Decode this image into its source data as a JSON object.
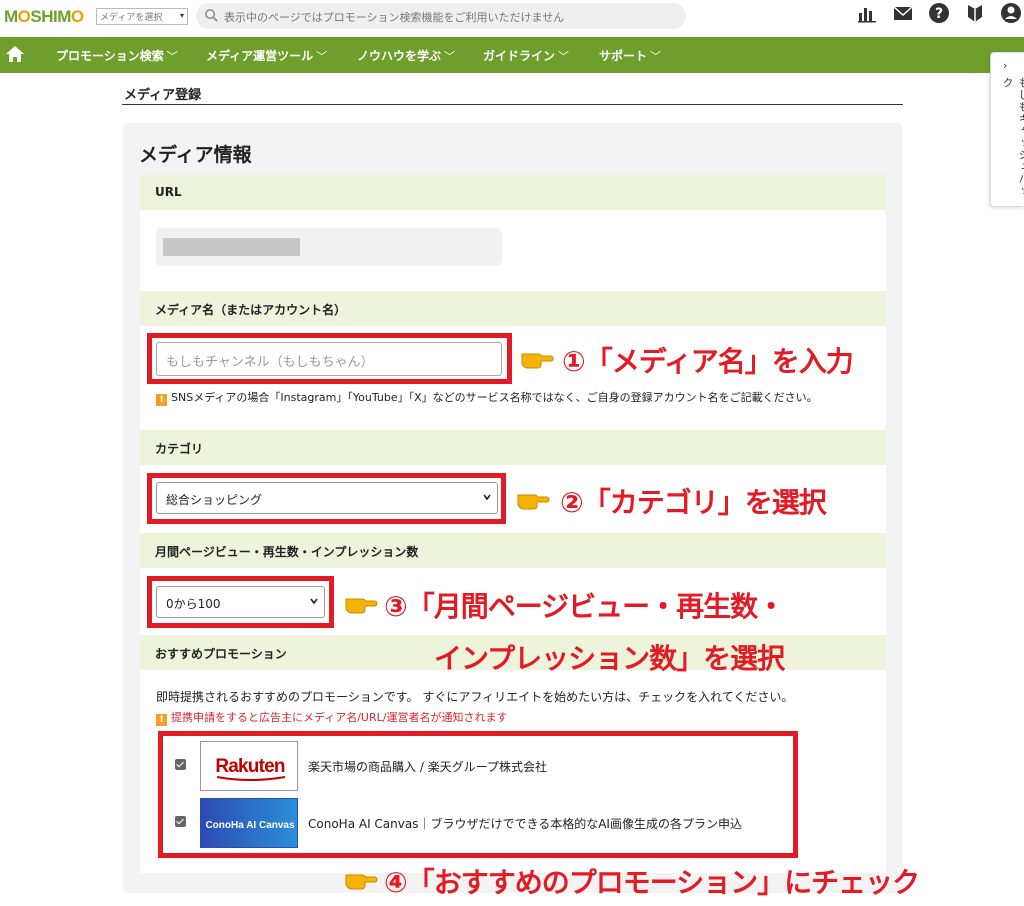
{
  "topbar": {
    "logo": "MOSHIMO",
    "media_select": "メディアを選択",
    "search_placeholder": "表示中のページではプロモーション検索機能をご利用いただけません"
  },
  "nav": {
    "items": [
      "プロモーション検索",
      "メディア運営ツール",
      "ノウハウを学ぶ",
      "ガイドライン",
      "サポート"
    ]
  },
  "side_tab": {
    "label": "もしもキャッシュバック"
  },
  "page": {
    "heading": "メディア登録"
  },
  "form": {
    "card_title": "メディア情報",
    "url": {
      "label": "URL"
    },
    "media_name": {
      "label": "メディア名（またはアカウント名）",
      "placeholder": "もしもチャンネル（もしもちゃん）",
      "note": "SNSメディアの場合「Instagram」「YouTube」「X」などのサービス名称ではなく、ご自身の登録アカウント名をご記載ください。"
    },
    "category": {
      "label": "カテゴリ",
      "selected": "総合ショッピング"
    },
    "pageviews": {
      "label": "月間ページビュー・再生数・インプレッション数",
      "selected": "0から100"
    },
    "promotions": {
      "label": "おすすめプロモーション",
      "lead": "即時提携されるおすすめのプロモーションです。 すぐにアフィリエイトを始めたい方は、チェックを入れてください。",
      "warning": "提携申請をすると広告主にメディア名/URL/運営者名が通知されます",
      "items": [
        {
          "logo": "Rakuten",
          "text": "楽天市場の商品購入 / 楽天グループ株式会社",
          "checked": true
        },
        {
          "logo": "ConoHa AI Canvas",
          "text": "ConoHa AI Canvas｜ブラウザだけでできる本格的なAI画像生成の各プラン申込",
          "checked": true
        }
      ]
    }
  },
  "callouts": {
    "step1": "①「メディア名」を入力",
    "step2": "②「カテゴリ」を選択",
    "step3_line1": "③「月間ページビュー・再生数・",
    "step3_line2": "インプレッション数」を選択",
    "step4": "④「おすすめのプロモーション」にチェック"
  },
  "colors": {
    "accent_green": "#6e9f2d",
    "section_bg": "#eef4dc",
    "annotation_red": "#e21b25"
  }
}
